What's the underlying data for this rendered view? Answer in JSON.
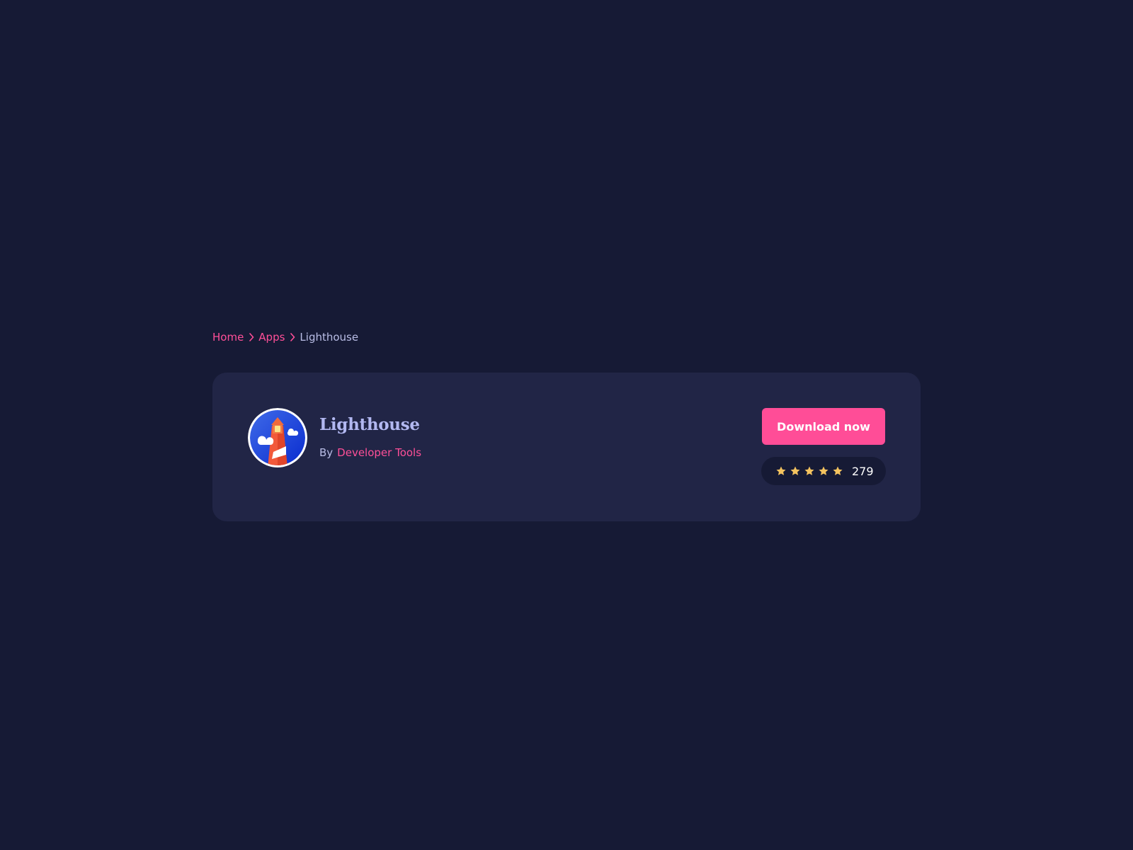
{
  "breadcrumb": {
    "items": [
      {
        "label": "Home"
      },
      {
        "label": "Apps"
      }
    ],
    "current": "Lighthouse"
  },
  "app": {
    "title": "Lighthouse",
    "by_label": "By",
    "developer": "Developer Tools",
    "logo_icon": "lighthouse-logo-icon"
  },
  "actions": {
    "download_label": "Download now"
  },
  "rating": {
    "stars": 5,
    "max_stars": 5,
    "count": "279"
  },
  "colors": {
    "background": "#161a35",
    "card": "#212546",
    "accent": "#ff4d97",
    "title": "#b2b8f1",
    "muted_text": "#b9bde6",
    "star": "#f4c35f"
  }
}
